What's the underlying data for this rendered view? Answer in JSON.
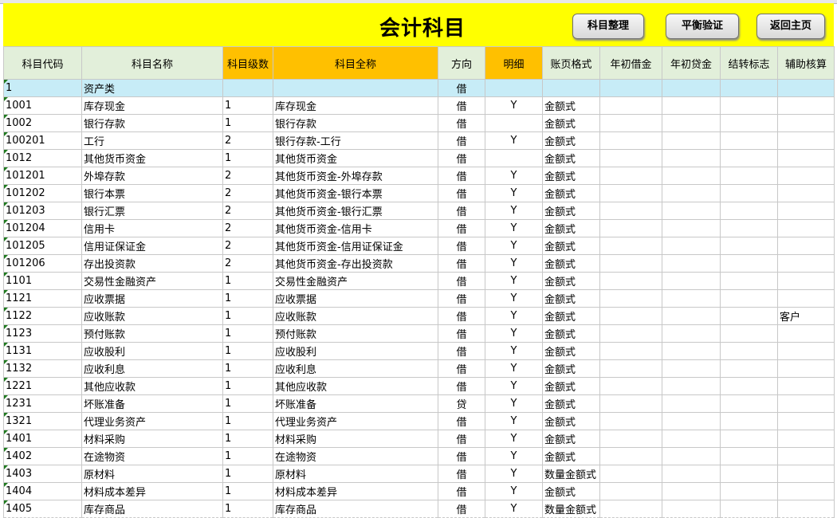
{
  "sheet": {
    "title": "会计科目",
    "buttons": {
      "organize": "科目整理",
      "verify": "平衡验证",
      "home": "返回主页"
    },
    "headers": [
      "科目代码",
      "科目名称",
      "科目级数",
      "科目全称",
      "方向",
      "明细",
      "账页格式",
      "年初借金",
      "年初贷金",
      "结转标志",
      "辅助核算"
    ],
    "rows": [
      [
        "1",
        "资产类",
        "",
        "",
        "借",
        "",
        "",
        "",
        "",
        "",
        ""
      ],
      [
        "1001",
        "库存现金",
        "1",
        "库存现金",
        "借",
        "Y",
        "金额式",
        "",
        "",
        "",
        ""
      ],
      [
        "1002",
        "银行存款",
        "1",
        "银行存款",
        "借",
        "",
        "金额式",
        "",
        "",
        "",
        ""
      ],
      [
        "100201",
        "工行",
        "2",
        "银行存款-工行",
        "借",
        "Y",
        "金额式",
        "",
        "",
        "",
        ""
      ],
      [
        "1012",
        "其他货币资金",
        "1",
        "其他货币资金",
        "借",
        "",
        "金额式",
        "",
        "",
        "",
        ""
      ],
      [
        "101201",
        "外埠存款",
        "2",
        "其他货币资金-外埠存款",
        "借",
        "Y",
        "金额式",
        "",
        "",
        "",
        ""
      ],
      [
        "101202",
        "银行本票",
        "2",
        "其他货币资金-银行本票",
        "借",
        "Y",
        "金额式",
        "",
        "",
        "",
        ""
      ],
      [
        "101203",
        "银行汇票",
        "2",
        "其他货币资金-银行汇票",
        "借",
        "Y",
        "金额式",
        "",
        "",
        "",
        ""
      ],
      [
        "101204",
        "信用卡",
        "2",
        "其他货币资金-信用卡",
        "借",
        "Y",
        "金额式",
        "",
        "",
        "",
        ""
      ],
      [
        "101205",
        "信用证保证金",
        "2",
        "其他货币资金-信用证保证金",
        "借",
        "Y",
        "金额式",
        "",
        "",
        "",
        ""
      ],
      [
        "101206",
        "存出投资款",
        "2",
        "其他货币资金-存出投资款",
        "借",
        "Y",
        "金额式",
        "",
        "",
        "",
        ""
      ],
      [
        "1101",
        "交易性金融资产",
        "1",
        "交易性金融资产",
        "借",
        "Y",
        "金额式",
        "",
        "",
        "",
        ""
      ],
      [
        "1121",
        "应收票据",
        "1",
        "应收票据",
        "借",
        "Y",
        "金额式",
        "",
        "",
        "",
        ""
      ],
      [
        "1122",
        "应收账款",
        "1",
        "应收账款",
        "借",
        "Y",
        "金额式",
        "",
        "",
        "",
        "客户"
      ],
      [
        "1123",
        "预付账款",
        "1",
        "预付账款",
        "借",
        "Y",
        "金额式",
        "",
        "",
        "",
        ""
      ],
      [
        "1131",
        "应收股利",
        "1",
        "应收股利",
        "借",
        "Y",
        "金额式",
        "",
        "",
        "",
        ""
      ],
      [
        "1132",
        "应收利息",
        "1",
        "应收利息",
        "借",
        "Y",
        "金额式",
        "",
        "",
        "",
        ""
      ],
      [
        "1221",
        "其他应收款",
        "1",
        "其他应收款",
        "借",
        "Y",
        "金额式",
        "",
        "",
        "",
        ""
      ],
      [
        "1231",
        "坏账准备",
        "1",
        "坏账准备",
        "贷",
        "Y",
        "金额式",
        "",
        "",
        "",
        ""
      ],
      [
        "1321",
        "代理业务资产",
        "1",
        "代理业务资产",
        "借",
        "Y",
        "金额式",
        "",
        "",
        "",
        ""
      ],
      [
        "1401",
        "材料采购",
        "1",
        "材料采购",
        "借",
        "Y",
        "金额式",
        "",
        "",
        "",
        ""
      ],
      [
        "1402",
        "在途物资",
        "1",
        "在途物资",
        "借",
        "Y",
        "金额式",
        "",
        "",
        "",
        ""
      ],
      [
        "1403",
        "原材料",
        "1",
        "原材料",
        "借",
        "Y",
        "数量金额式",
        "",
        "",
        "",
        ""
      ],
      [
        "1404",
        "材料成本差异",
        "1",
        "材料成本差异",
        "借",
        "Y",
        "金额式",
        "",
        "",
        "",
        ""
      ],
      [
        "1405",
        "库存商品",
        "1",
        "库存商品",
        "借",
        "Y",
        "数量金额式",
        "",
        "",
        "",
        ""
      ]
    ]
  },
  "colors": {
    "banner": "#ffff00",
    "header_green": "#e2efda",
    "header_orange": "#ffc000",
    "category_row": "#c7ecf7"
  }
}
